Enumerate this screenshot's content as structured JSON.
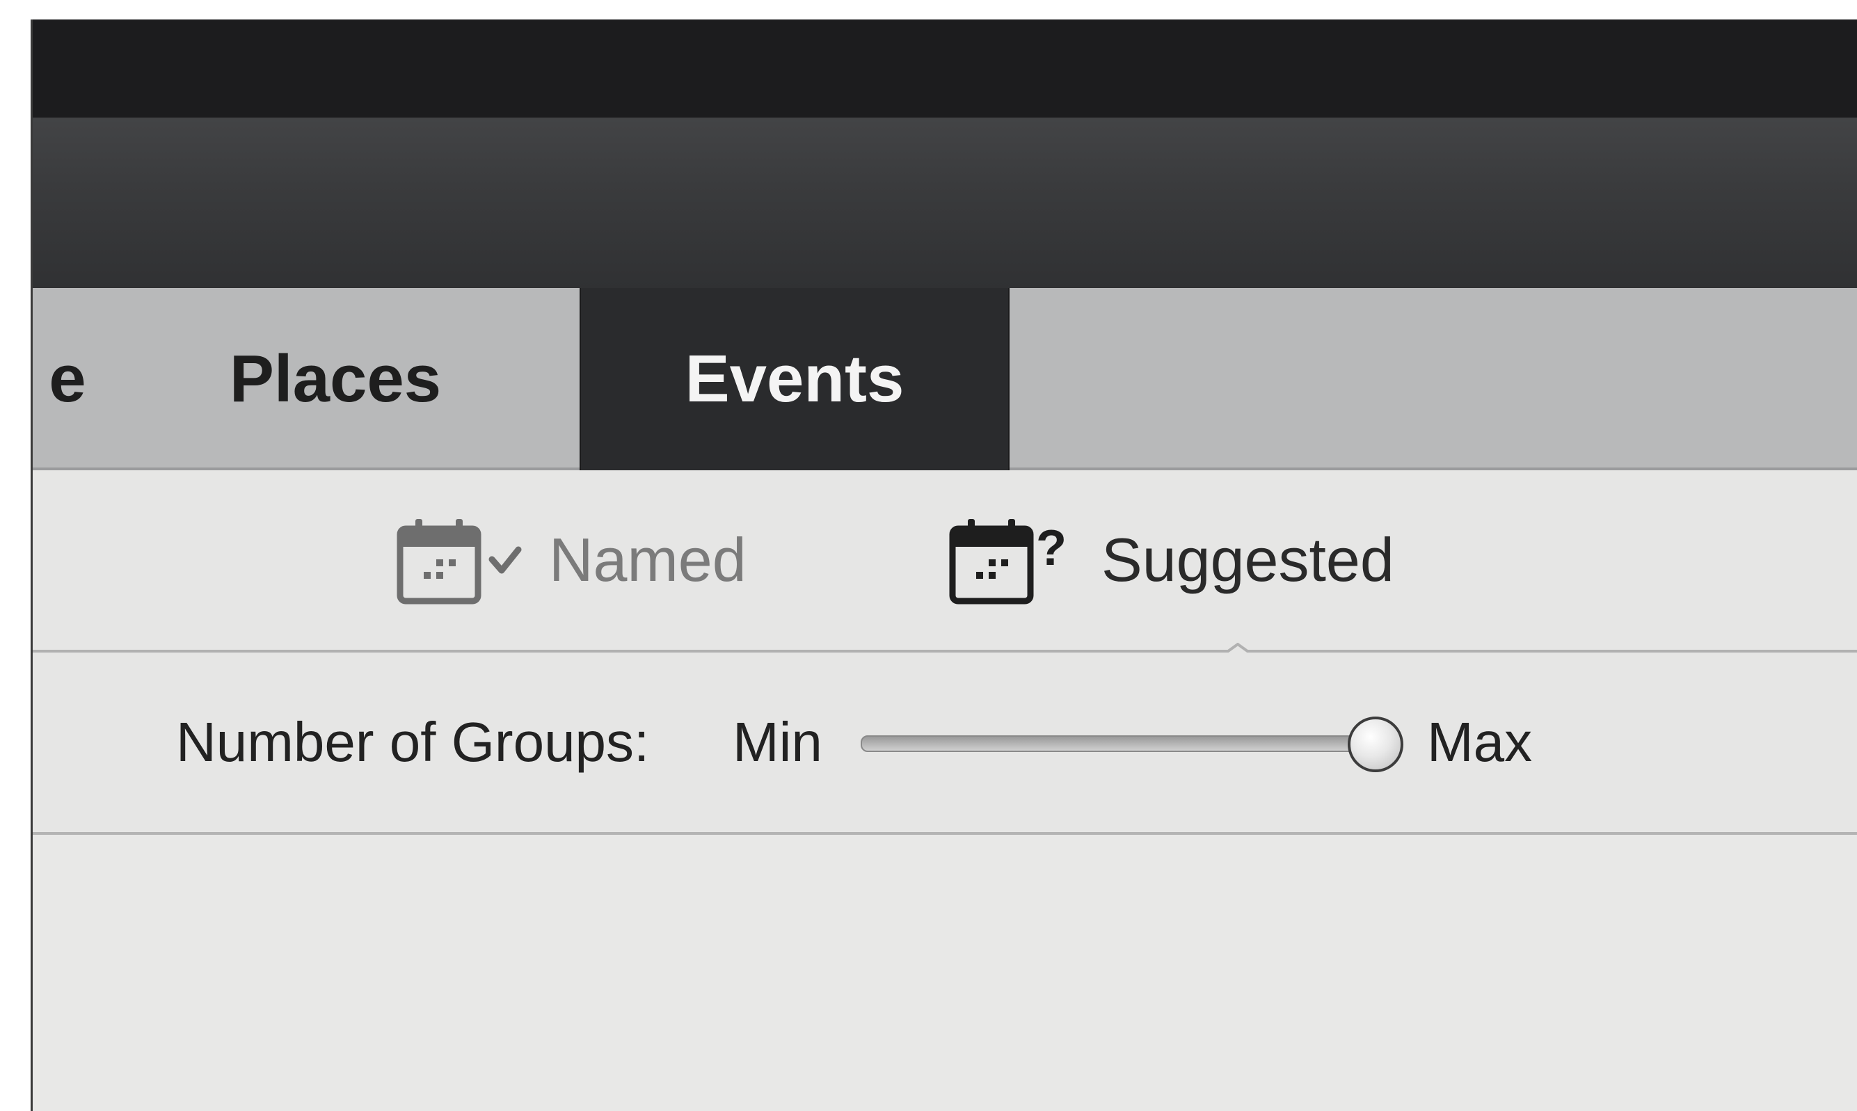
{
  "tabs": [
    {
      "label": "e"
    },
    {
      "label": "Places"
    },
    {
      "label": "Events",
      "active": true
    }
  ],
  "subtabs": [
    {
      "label": "Named",
      "icon": "calendar-check-icon"
    },
    {
      "label": "Suggested",
      "icon": "calendar-question-icon",
      "active": true
    }
  ],
  "groups_slider": {
    "label": "Number of Groups:",
    "min_label": "Min",
    "max_label": "Max",
    "value_fraction": 1.0
  },
  "colors": {
    "active_tab_bg": "#2a2b2d",
    "tab_bar_bg": "#b8b9ba",
    "panel_bg": "#e6e6e5"
  }
}
